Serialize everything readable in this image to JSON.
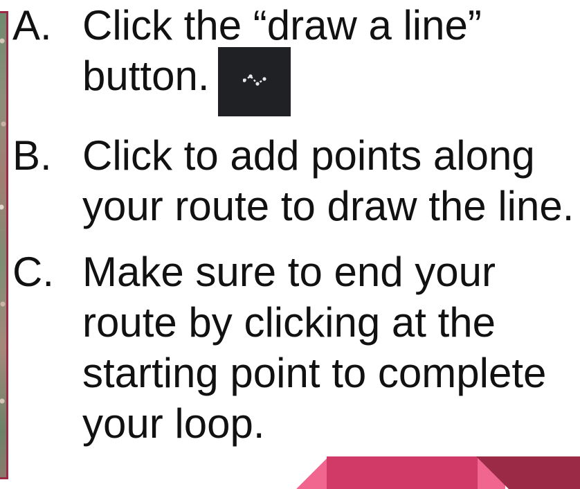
{
  "steps": [
    {
      "letter": "A.",
      "text": "Click the “draw a line” button."
    },
    {
      "letter": "B.",
      "text": "Click to add points along your route to draw the line."
    },
    {
      "letter": "C.",
      "text": "Make sure to end your route by clicking at the starting point to complete your loop."
    }
  ],
  "draw_line_button": {
    "icon": "polyline-icon",
    "background": "#202124"
  },
  "colors": {
    "ribbon_light": "#f0668f",
    "ribbon_mid": "#d13a67",
    "ribbon_dark": "#9a2a45",
    "map_border": "#9a2a45"
  }
}
